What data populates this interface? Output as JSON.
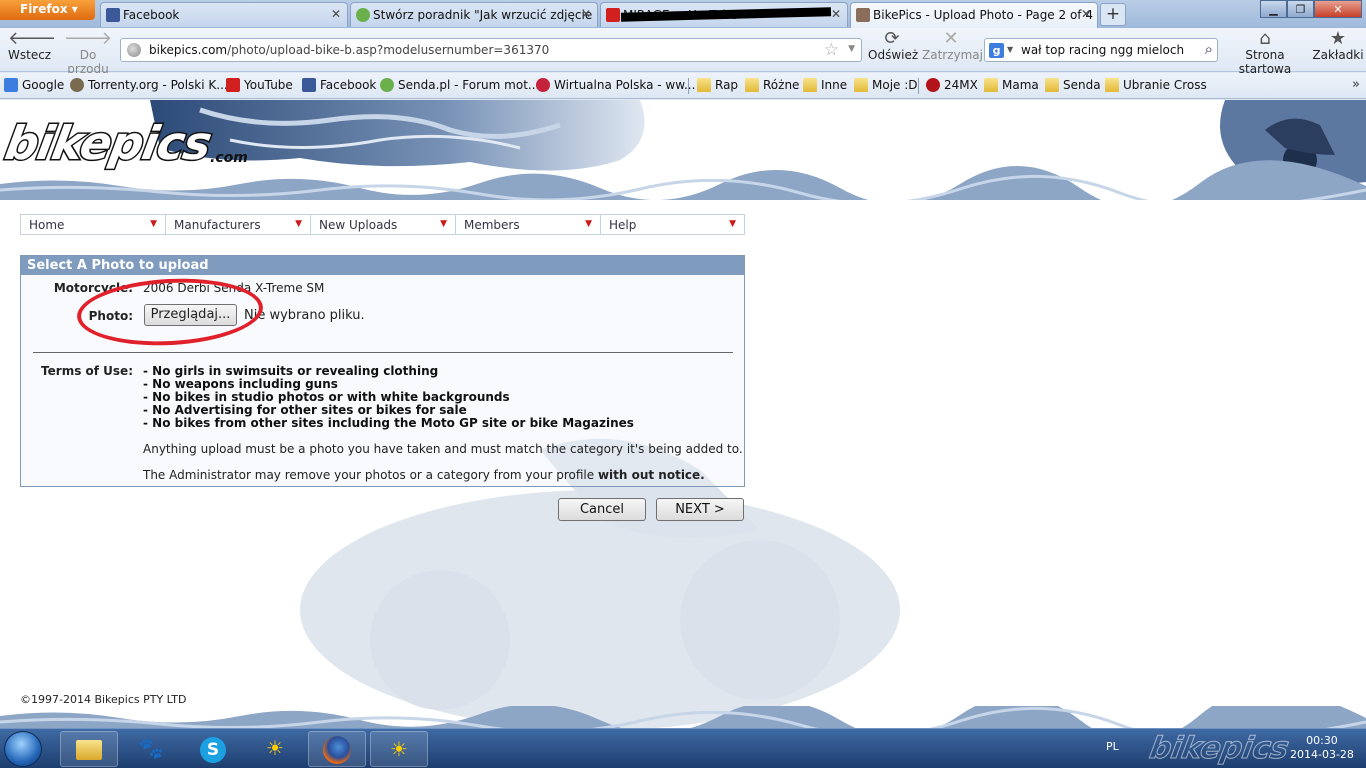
{
  "browser": {
    "app_button": "Firefox",
    "tabs": [
      {
        "title": "Facebook",
        "close": "✕"
      },
      {
        "title": "Stwórz poradnik \"Jak wrzucić zdjęcie ...",
        "close": "✕"
      },
      {
        "title": "MIRAGE ... YouTube",
        "close": "✕"
      },
      {
        "title": "BikePics - Upload Photo - Page 2 of 4",
        "close": "✕"
      }
    ],
    "new_tab": "+",
    "nav": {
      "back": "Wstecz",
      "forward": "Do przodu",
      "reload": "Odśwież",
      "stop": "Zatrzymaj",
      "home": "Strona startowa",
      "bookmarks": "Zakładki"
    },
    "url": {
      "host": "bikepics.com",
      "path": "/photo/upload-bike-b.asp?modelusernumber=361370"
    },
    "search_value": "wał top racing ngg mieloch",
    "bookmarks_bar": [
      "Google",
      "Torrenty.org - Polski K...",
      "YouTube",
      "Facebook",
      "Senda.pl - Forum mot...",
      "Wirtualna Polska - ww...",
      "Rap",
      "Różne",
      "Inne",
      "Moje :D",
      "24MX",
      "Mama",
      "Senda",
      "Ubranie Cross"
    ],
    "bookmarks_more": "»"
  },
  "site": {
    "logo": "bikepics",
    "logo_sub": ".com",
    "menu": [
      {
        "label": "Home"
      },
      {
        "label": "Manufacturers"
      },
      {
        "label": "New Uploads"
      },
      {
        "label": "Members"
      },
      {
        "label": "Help"
      }
    ],
    "panel": {
      "header": "Select A Photo to upload",
      "motorcycle_label": "Motorcycle:",
      "motorcycle_value": "2006 Derbi Senda X-Treme SM",
      "photo_label": "Photo:",
      "browse_button": "Przeglądaj...",
      "file_status": "Nie wybrano pliku.",
      "terms_label": "Terms of Use:",
      "terms": [
        "- No girls in swimsuits or revealing clothing",
        "- No weapons including guns",
        "- No bikes in studio photos or with white backgrounds",
        "- No Advertising for other sites or bikes for sale",
        "- No bikes from other sites including the Moto GP site or bike Magazines"
      ],
      "para1": "Anything upload must be a photo you have taken and must match the category it's being added to.",
      "para2_prefix": "The Administrator may remove your photos or a category from your profile ",
      "para2_bold": "with out notice."
    },
    "cancel_button": "Cancel",
    "next_button": "NEXT >",
    "copyright": "©1997-2014 Bikepics PTY LTD"
  },
  "taskbar": {
    "lang": "PL",
    "time": "00:30",
    "date": "2014-03-28"
  },
  "colors": {
    "panel_header": "#7f9bbe",
    "menu_caret": "#cc1a1a",
    "annotation_circle": "#e0202a"
  }
}
